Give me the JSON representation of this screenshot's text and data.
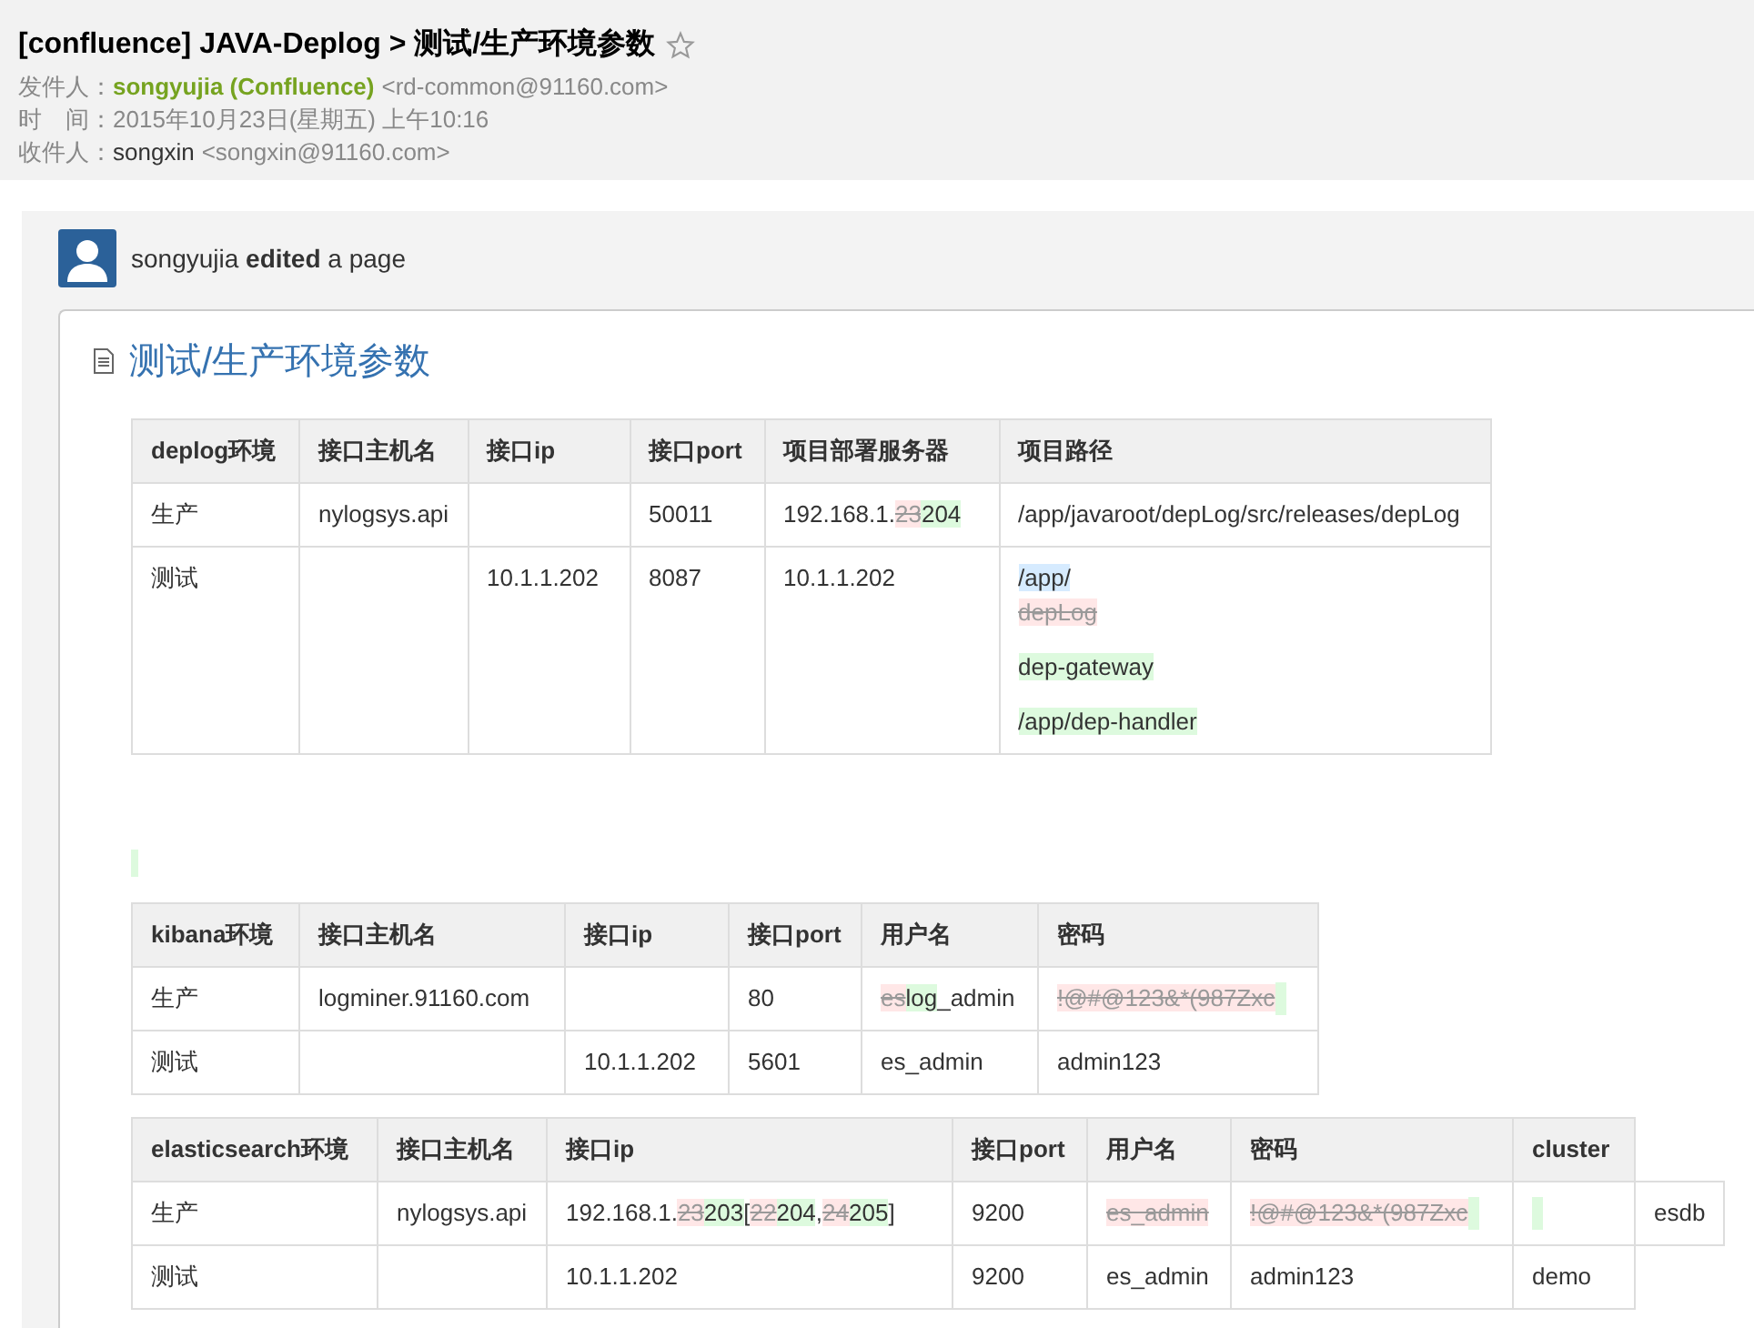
{
  "email": {
    "subject": "[confluence] JAVA-Deplog > 测试/生产环境参数",
    "starred": false,
    "fields": [
      {
        "label": "发件人：",
        "name": "songyujia (Confluence)",
        "address": "<rd-common@91160.com>",
        "kind": "sender"
      },
      {
        "label": "时　间：",
        "name": "2015年10月23日(星期五) 上午10:16",
        "kind": "date"
      },
      {
        "label": "收件人：",
        "name": "songxin",
        "address": "<songxin@91160.com>",
        "kind": "recipient"
      }
    ]
  },
  "activity": {
    "user": "songyujia",
    "action": "edited",
    "rest": "a page"
  },
  "page": {
    "title": "测试/生产环境参数",
    "blocks": [
      {
        "kind": "table",
        "columns": [
          "deplog环境",
          "接口主机名",
          "接口ip",
          "接口port",
          "项目部署服务器",
          "项目路径"
        ],
        "rows": [
          [
            {
              "segs": [
                {
                  "text": "生产",
                  "kind": "plain"
                }
              ]
            },
            {
              "segs": [
                {
                  "text": "nylogsys.api",
                  "kind": "plain"
                }
              ]
            },
            {},
            {
              "segs": [
                {
                  "text": "50011",
                  "kind": "plain"
                }
              ]
            },
            {
              "segs": [
                {
                  "text": "192.168.1.",
                  "kind": "plain"
                },
                {
                  "text": "23",
                  "kind": "deleted"
                },
                {
                  "text": "204",
                  "kind": "inserted"
                }
              ]
            },
            {
              "segs": [
                {
                  "text": "/app/javaroot/depLog/src/releases/depLog",
                  "kind": "plain"
                }
              ]
            }
          ],
          [
            {
              "segs": [
                {
                  "text": "测试",
                  "kind": "plain"
                }
              ]
            },
            {},
            {
              "segs": [
                {
                  "text": "10.1.1.202",
                  "kind": "plain"
                }
              ]
            },
            {
              "segs": [
                {
                  "text": "8087",
                  "kind": "plain"
                }
              ]
            },
            {
              "segs": [
                {
                  "text": "10.1.1.202",
                  "kind": "plain"
                }
              ]
            },
            {
              "lines": [
                {
                  "segs": [
                    {
                      "text": "/app/",
                      "kind": "changed"
                    }
                  ]
                },
                {
                  "segs": [
                    {
                      "text": "depLog",
                      "kind": "deleted"
                    }
                  ]
                },
                {
                  "segs": [
                    {
                      "text": "dep-gateway",
                      "kind": "inserted"
                    }
                  ]
                },
                {
                  "segs": [
                    {
                      "text": "/app/dep-handler",
                      "kind": "inserted"
                    }
                  ]
                }
              ]
            }
          ]
        ]
      },
      {
        "kind": "insert-mark"
      },
      {
        "kind": "table",
        "columns": [
          "kibana环境",
          "接口主机名",
          "接口ip",
          "接口port",
          "用户名",
          "密码"
        ],
        "rows": [
          [
            {
              "segs": [
                {
                  "text": "生产",
                  "kind": "plain"
                }
              ]
            },
            {
              "segs": [
                {
                  "text": "logminer.91160.com",
                  "kind": "plain"
                }
              ]
            },
            {},
            {
              "segs": [
                {
                  "text": "80",
                  "kind": "plain"
                }
              ]
            },
            {
              "segs": [
                {
                  "text": "es",
                  "kind": "deleted"
                },
                {
                  "text": "log",
                  "kind": "inserted"
                },
                {
                  "text": "_admin",
                  "kind": "plain"
                }
              ]
            },
            {
              "segs": [
                {
                  "text": "!@#@123&*(987Zxc",
                  "kind": "deleted"
                }
              ],
              "tail_insert": true
            }
          ],
          [
            {
              "segs": [
                {
                  "text": "测试",
                  "kind": "plain"
                }
              ]
            },
            {},
            {
              "segs": [
                {
                  "text": "10.1.1.202",
                  "kind": "plain"
                }
              ]
            },
            {
              "segs": [
                {
                  "text": "5601",
                  "kind": "plain"
                }
              ]
            },
            {
              "segs": [
                {
                  "text": "es_admin",
                  "kind": "plain"
                }
              ]
            },
            {
              "segs": [
                {
                  "text": "admin123",
                  "kind": "plain"
                }
              ]
            }
          ]
        ]
      },
      {
        "kind": "table",
        "columns": [
          "elasticsearch环境",
          "接口主机名",
          "接口ip",
          "接口port",
          "用户名",
          "密码",
          "cluster"
        ],
        "rows": [
          [
            {
              "segs": [
                {
                  "text": "生产",
                  "kind": "plain"
                }
              ]
            },
            {
              "segs": [
                {
                  "text": "nylogsys.api",
                  "kind": "plain"
                }
              ]
            },
            {
              "segs": [
                {
                  "text": "192.168.1.",
                  "kind": "plain"
                },
                {
                  "text": "23",
                  "kind": "deleted"
                },
                {
                  "text": "203",
                  "kind": "inserted"
                },
                {
                  "text": "[",
                  "kind": "plain"
                },
                {
                  "text": "22",
                  "kind": "deleted"
                },
                {
                  "text": "204",
                  "kind": "inserted"
                },
                {
                  "text": ",",
                  "kind": "plain"
                },
                {
                  "text": "24",
                  "kind": "deleted"
                },
                {
                  "text": "205",
                  "kind": "inserted"
                },
                {
                  "text": "]",
                  "kind": "plain"
                }
              ]
            },
            {
              "segs": [
                {
                  "text": "9200",
                  "kind": "plain"
                }
              ]
            },
            {
              "segs": [
                {
                  "text": "es_admin",
                  "kind": "deleted"
                }
              ]
            },
            {
              "segs": [
                {
                  "text": "!@#@123&*(987Zxc",
                  "kind": "deleted"
                }
              ],
              "tail_insert": true
            },
            {
              "tail_insert": true
            },
            {
              "segs": [
                {
                  "text": "esdb",
                  "kind": "plain"
                }
              ]
            }
          ],
          [
            {
              "segs": [
                {
                  "text": "测试",
                  "kind": "plain"
                }
              ]
            },
            {},
            {
              "segs": [
                {
                  "text": "10.1.1.202",
                  "kind": "plain"
                }
              ]
            },
            {
              "segs": [
                {
                  "text": "9200",
                  "kind": "plain"
                }
              ]
            },
            {
              "segs": [
                {
                  "text": "es_admin",
                  "kind": "plain"
                }
              ]
            },
            {
              "segs": [
                {
                  "text": "admin123",
                  "kind": "plain"
                }
              ]
            },
            {
              "segs": [
                {
                  "text": "demo",
                  "kind": "plain"
                }
              ]
            }
          ]
        ]
      }
    ]
  }
}
